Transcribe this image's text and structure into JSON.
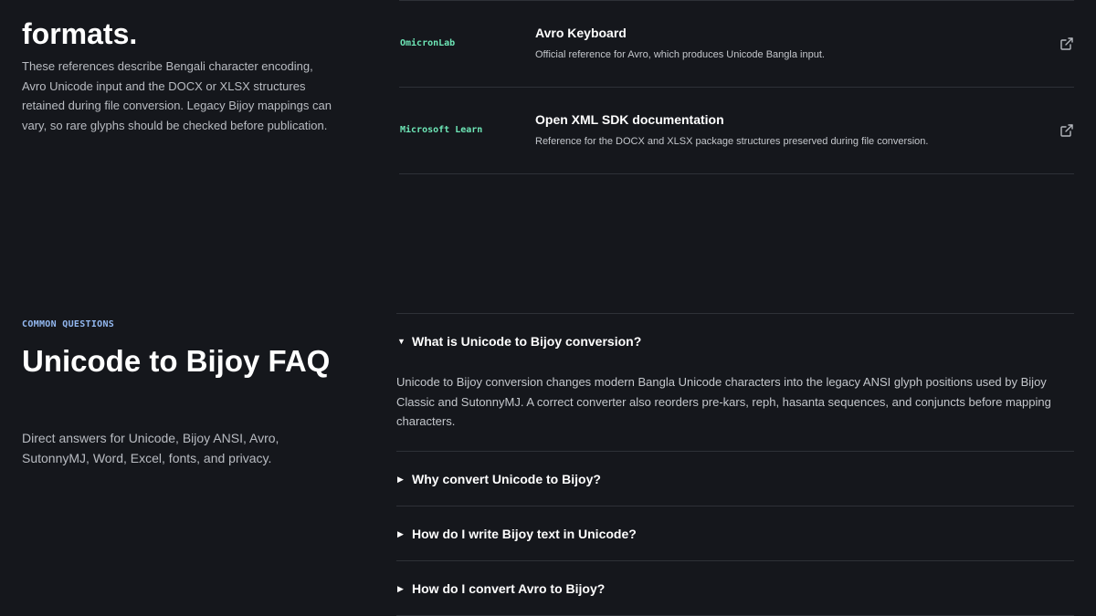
{
  "references": {
    "heading": "formats.",
    "description": "These references describe Bengali character encoding, Avro Unicode input and the DOCX or XLSX structures retained during file conversion. Legacy Bijoy mappings can vary, so rare glyphs should be checked before publication.",
    "items": [
      {
        "source": "OmicronLab",
        "title": "Avro Keyboard",
        "subtitle": "Official reference for Avro, which produces Unicode Bangla input.",
        "icon": "external-link-icon"
      },
      {
        "source": "Microsoft Learn",
        "title": "Open XML SDK documentation",
        "subtitle": "Reference for the DOCX and XLSX package structures preserved during file conversion.",
        "icon": "external-link-icon"
      }
    ]
  },
  "faq": {
    "eyebrow": "COMMON QUESTIONS",
    "title": "Unicode to Bijoy FAQ",
    "description": "Direct answers for Unicode, Bijoy ANSI, Avro, SutonnyMJ, Word, Excel, fonts, and privacy.",
    "items": [
      {
        "question": "What is Unicode to Bijoy conversion?",
        "answer": "Unicode to Bijoy conversion changes modern Bangla Unicode characters into the legacy ANSI glyph positions used by Bijoy Classic and SutonnyMJ. A correct converter also reorders pre-kars, reph, hasanta sequences, and conjuncts before mapping characters.",
        "expanded": true
      },
      {
        "question": "Why convert Unicode to Bijoy?",
        "expanded": false
      },
      {
        "question": "How do I write Bijoy text in Unicode?",
        "expanded": false
      },
      {
        "question": "How do I convert Avro to Bijoy?",
        "expanded": false
      }
    ]
  },
  "colors": {
    "background": "#15171c",
    "source_label": "#6ee7b7",
    "eyebrow": "#93b8f0",
    "divider": "#2e3137"
  }
}
